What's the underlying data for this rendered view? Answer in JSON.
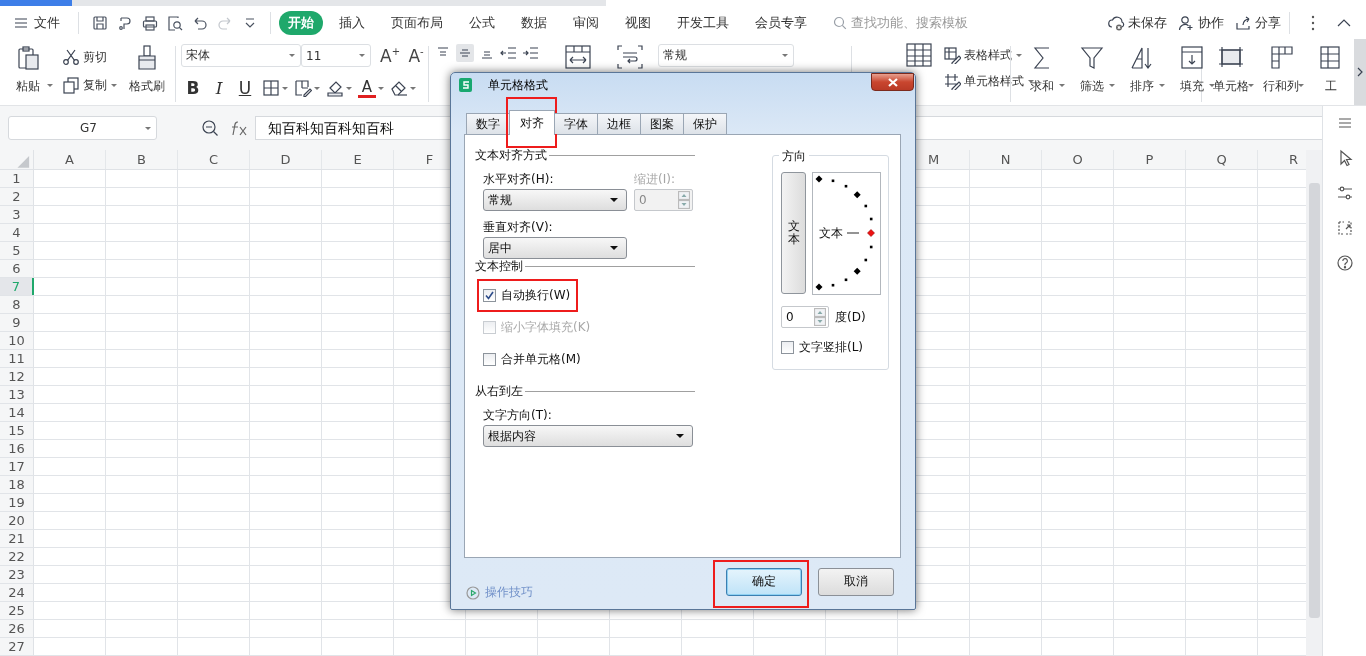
{
  "menu_bar": {
    "file_label": "文件",
    "tabs": [
      {
        "label": "开始",
        "selected": true
      },
      {
        "label": "插入",
        "selected": false
      },
      {
        "label": "页面布局",
        "selected": false
      },
      {
        "label": "公式",
        "selected": false
      },
      {
        "label": "数据",
        "selected": false
      },
      {
        "label": "审阅",
        "selected": false
      },
      {
        "label": "视图",
        "selected": false
      },
      {
        "label": "开发工具",
        "selected": false
      },
      {
        "label": "会员专享",
        "selected": false
      }
    ],
    "search": {
      "placeholder": "查找功能、搜索模板"
    },
    "actions": [
      "未保存",
      "协作",
      "分享"
    ]
  },
  "ribbon": {
    "clipboard": {
      "paste": "粘贴",
      "cut": "剪切",
      "copy": "复制",
      "format_painter": "格式刷"
    },
    "font": {
      "family": "宋体",
      "size": "11",
      "grow": "A$^{+}$",
      "shrink": "A$^{-}$",
      "bold": "B",
      "italic": "I",
      "underline": "U",
      "font_color_letter": "A"
    },
    "number_format": "常规",
    "styles": [
      "表格样式",
      "单元格样式"
    ],
    "editing": [
      "求和",
      "筛选",
      "排序",
      "填充"
    ],
    "cells": [
      "单元格",
      "行和列",
      "工"
    ]
  },
  "formula_bar": {
    "cell": "G7",
    "content": "知百科知百科知百科"
  },
  "sheet": {
    "columns_left": [
      "A",
      "B",
      "C",
      "D",
      "E",
      "F"
    ],
    "columns_right": [
      "M",
      "N",
      "O",
      "P",
      "Q",
      "R"
    ],
    "rows": [
      {
        "label": "1",
        "selected": false
      },
      {
        "label": "2",
        "selected": false
      },
      {
        "label": "3",
        "selected": false
      },
      {
        "label": "4",
        "selected": false
      },
      {
        "label": "5",
        "selected": false
      },
      {
        "label": "6",
        "selected": false
      },
      {
        "label": "7",
        "selected": true
      },
      {
        "label": "8",
        "selected": false
      },
      {
        "label": "9",
        "selected": false
      },
      {
        "label": "10",
        "selected": false
      },
      {
        "label": "11",
        "selected": false
      },
      {
        "label": "12",
        "selected": false
      },
      {
        "label": "13",
        "selected": false
      },
      {
        "label": "14",
        "selected": false
      },
      {
        "label": "15",
        "selected": false
      },
      {
        "label": "16",
        "selected": false
      },
      {
        "label": "17",
        "selected": false
      },
      {
        "label": "18",
        "selected": false
      },
      {
        "label": "19",
        "selected": false
      },
      {
        "label": "20",
        "selected": false
      },
      {
        "label": "21",
        "selected": false
      },
      {
        "label": "22",
        "selected": false
      },
      {
        "label": "23",
        "selected": false
      },
      {
        "label": "24",
        "selected": false
      },
      {
        "label": "25",
        "selected": false
      },
      {
        "label": "26",
        "selected": false
      },
      {
        "label": "27",
        "selected": false
      }
    ]
  },
  "dialog": {
    "title": "单元格格式",
    "tabs": [
      {
        "label": "数字",
        "selected": false,
        "highlighted": false
      },
      {
        "label": "对齐",
        "selected": true,
        "highlighted": true
      },
      {
        "label": "字体",
        "selected": false,
        "highlighted": false
      },
      {
        "label": "边框",
        "selected": false,
        "highlighted": false
      },
      {
        "label": "图案",
        "selected": false,
        "highlighted": false
      },
      {
        "label": "保护",
        "selected": false,
        "highlighted": false
      }
    ],
    "alignment": {
      "legend": "文本对齐方式",
      "horizontal": {
        "label": "水平对齐(H):",
        "value": "常规"
      },
      "indent": {
        "label": "缩进(I):",
        "value": "0",
        "disabled": true
      },
      "vertical": {
        "label": "垂直对齐(V):",
        "value": "居中"
      }
    },
    "text_control": {
      "legend": "文本控制",
      "options": [
        {
          "label": "自动换行(W)",
          "checked": true,
          "disabled": false,
          "highlighted": true
        },
        {
          "label": "缩小字体填充(K)",
          "checked": false,
          "disabled": true,
          "highlighted": false
        },
        {
          "label": "合并单元格(M)",
          "checked": false,
          "disabled": false,
          "highlighted": false
        }
      ]
    },
    "right_to_left": {
      "legend": "从右到左",
      "direction": {
        "label": "文字方向(T):",
        "value": "根据内容"
      }
    },
    "orientation": {
      "legend": "方向",
      "vertical_text": "文本",
      "dial_text": "文本",
      "degrees": {
        "value": "0",
        "label": "度(D)"
      },
      "stacked": {
        "label": "文字竖排(L)",
        "checked": false
      }
    },
    "tips_link": "操作技巧",
    "buttons": [
      {
        "label": "确定",
        "default": true,
        "highlighted": true
      },
      {
        "label": "取消",
        "default": false,
        "highlighted": false
      }
    ]
  }
}
